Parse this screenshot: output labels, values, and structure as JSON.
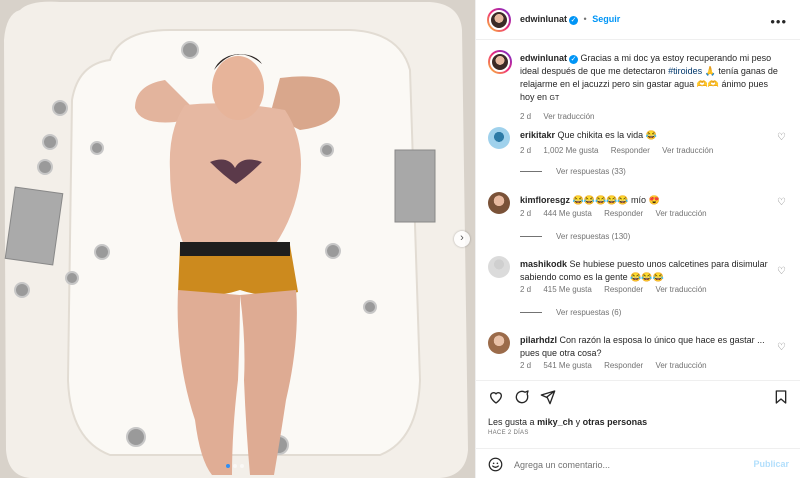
{
  "post": {
    "author": "edwinlunat",
    "follow_label": "Seguir",
    "more_icon": "more-horizontal-icon",
    "caption_text": "Gracias a mi doc ya estoy recuperando mi peso ideal después de que me detectaron",
    "caption_hashtag": "#tiroides",
    "caption_rest": "🙏 tenía ganas de relajarme en el jacuzzi pero sin gastar agua 🫶🫶 ánimo pues hoy en",
    "caption_flag": "GT",
    "caption_age": "2 d",
    "caption_translate": "Ver traducción"
  },
  "carousel": {
    "next_icon": "chevron-right-icon",
    "slides": 3,
    "active": 1
  },
  "comments": [
    {
      "user": "erikitakr",
      "text": "Que chikita es la vida 😂",
      "age": "2 d",
      "likes": "1,002 Me gusta",
      "reply": "Responder",
      "translate": "Ver traducción",
      "replies": "Ver respuestas (33)"
    },
    {
      "user": "kimfloresgz",
      "text": "😂😂😂😂😂 mío 😍",
      "age": "2 d",
      "likes": "444 Me gusta",
      "reply": "Responder",
      "translate": "Ver traducción",
      "replies": "Ver respuestas (130)"
    },
    {
      "user": "mashikodk",
      "text": "Se hubiese puesto unos calcetines para disimular sabiendo como es la gente 😂😂😂",
      "age": "2 d",
      "likes": "415 Me gusta",
      "reply": "Responder",
      "translate": "Ver traducción",
      "replies": "Ver respuestas (6)"
    },
    {
      "user": "pilarhdzl",
      "text": "Con razón la esposa lo único que hace es gastar ... pues que otra cosa?",
      "age": "2 d",
      "likes": "541 Me gusta",
      "reply": "Responder",
      "translate": "Ver traducción"
    }
  ],
  "actions": {
    "like_icon": "heart-icon",
    "comment_icon": "comment-icon",
    "share_icon": "send-icon",
    "save_icon": "bookmark-icon",
    "likes_prefix": "Les gusta a",
    "likes_user": "miky_ch",
    "likes_and": "y",
    "likes_others": "otras personas",
    "date": "HACE 2 DÍAS"
  },
  "composer": {
    "placeholder": "Agrega un comentario...",
    "publish": "Publicar",
    "emoji_icon": "emoji-icon"
  },
  "colors": {
    "accent": "#0095f6",
    "text": "#262626",
    "muted": "#737373",
    "hashtag": "#00376b"
  }
}
